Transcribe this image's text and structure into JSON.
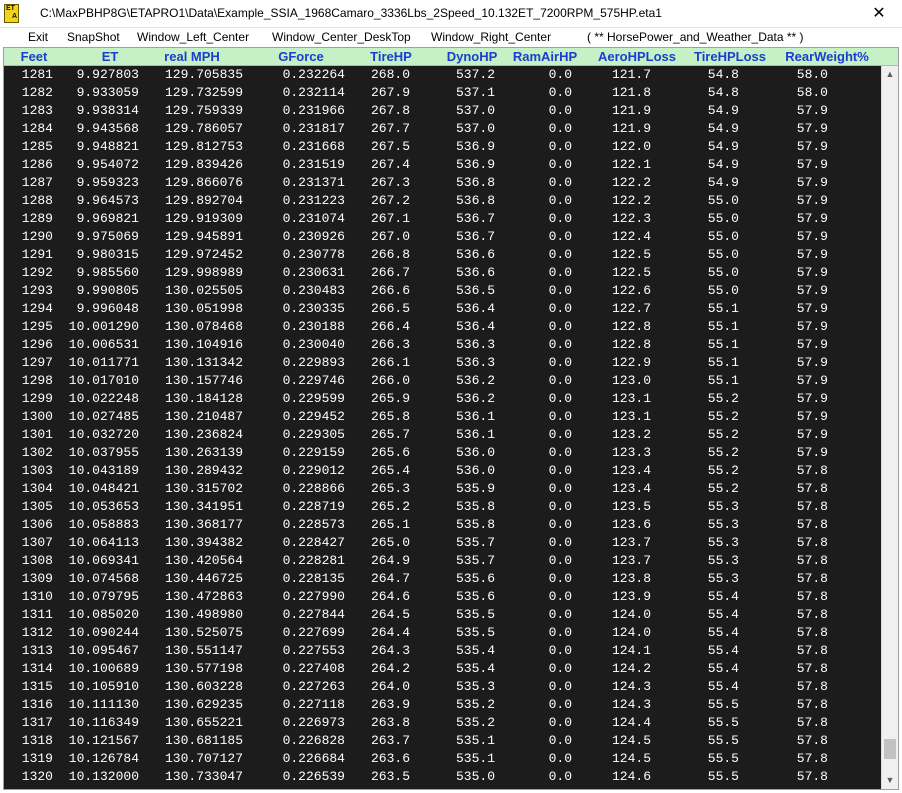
{
  "window": {
    "app_icon_text": [
      "ET",
      "A"
    ],
    "title": "C:\\MaxPBHP8G\\ETAPRO1\\Data\\Example_SSIA_1968Camaro_3336Lbs_2Speed_10.132ET_7200RPM_575HP.eta1",
    "close_glyph": "✕"
  },
  "menu": {
    "items": [
      "Exit",
      "SnapShot",
      "Window_Left_Center",
      "Window_Center_DeskTop",
      "Window_Right_Center"
    ],
    "note": "( ** HorsePower_and_Weather_Data ** )"
  },
  "table": {
    "columns": [
      "Feet",
      "ET",
      "real MPH",
      "GForce",
      "TireHP",
      "DynoHP",
      "RamAirHP",
      "AeroHPLoss",
      "TireHPLoss",
      "RearWeight%"
    ],
    "rows": [
      [
        "1281",
        "9.927803",
        "129.705835",
        "0.232264",
        "268.0",
        "537.2",
        "0.0",
        "121.7",
        "54.8",
        "58.0"
      ],
      [
        "1282",
        "9.933059",
        "129.732599",
        "0.232114",
        "267.9",
        "537.1",
        "0.0",
        "121.8",
        "54.8",
        "58.0"
      ],
      [
        "1283",
        "9.938314",
        "129.759339",
        "0.231966",
        "267.8",
        "537.0",
        "0.0",
        "121.9",
        "54.9",
        "57.9"
      ],
      [
        "1284",
        "9.943568",
        "129.786057",
        "0.231817",
        "267.7",
        "537.0",
        "0.0",
        "121.9",
        "54.9",
        "57.9"
      ],
      [
        "1285",
        "9.948821",
        "129.812753",
        "0.231668",
        "267.5",
        "536.9",
        "0.0",
        "122.0",
        "54.9",
        "57.9"
      ],
      [
        "1286",
        "9.954072",
        "129.839426",
        "0.231519",
        "267.4",
        "536.9",
        "0.0",
        "122.1",
        "54.9",
        "57.9"
      ],
      [
        "1287",
        "9.959323",
        "129.866076",
        "0.231371",
        "267.3",
        "536.8",
        "0.0",
        "122.2",
        "54.9",
        "57.9"
      ],
      [
        "1288",
        "9.964573",
        "129.892704",
        "0.231223",
        "267.2",
        "536.8",
        "0.0",
        "122.2",
        "55.0",
        "57.9"
      ],
      [
        "1289",
        "9.969821",
        "129.919309",
        "0.231074",
        "267.1",
        "536.7",
        "0.0",
        "122.3",
        "55.0",
        "57.9"
      ],
      [
        "1290",
        "9.975069",
        "129.945891",
        "0.230926",
        "267.0",
        "536.7",
        "0.0",
        "122.4",
        "55.0",
        "57.9"
      ],
      [
        "1291",
        "9.980315",
        "129.972452",
        "0.230778",
        "266.8",
        "536.6",
        "0.0",
        "122.5",
        "55.0",
        "57.9"
      ],
      [
        "1292",
        "9.985560",
        "129.998989",
        "0.230631",
        "266.7",
        "536.6",
        "0.0",
        "122.5",
        "55.0",
        "57.9"
      ],
      [
        "1293",
        "9.990805",
        "130.025505",
        "0.230483",
        "266.6",
        "536.5",
        "0.0",
        "122.6",
        "55.0",
        "57.9"
      ],
      [
        "1294",
        "9.996048",
        "130.051998",
        "0.230335",
        "266.5",
        "536.4",
        "0.0",
        "122.7",
        "55.1",
        "57.9"
      ],
      [
        "1295",
        "10.001290",
        "130.078468",
        "0.230188",
        "266.4",
        "536.4",
        "0.0",
        "122.8",
        "55.1",
        "57.9"
      ],
      [
        "1296",
        "10.006531",
        "130.104916",
        "0.230040",
        "266.3",
        "536.3",
        "0.0",
        "122.8",
        "55.1",
        "57.9"
      ],
      [
        "1297",
        "10.011771",
        "130.131342",
        "0.229893",
        "266.1",
        "536.3",
        "0.0",
        "122.9",
        "55.1",
        "57.9"
      ],
      [
        "1298",
        "10.017010",
        "130.157746",
        "0.229746",
        "266.0",
        "536.2",
        "0.0",
        "123.0",
        "55.1",
        "57.9"
      ],
      [
        "1299",
        "10.022248",
        "130.184128",
        "0.229599",
        "265.9",
        "536.2",
        "0.0",
        "123.1",
        "55.2",
        "57.9"
      ],
      [
        "1300",
        "10.027485",
        "130.210487",
        "0.229452",
        "265.8",
        "536.1",
        "0.0",
        "123.1",
        "55.2",
        "57.9"
      ],
      [
        "1301",
        "10.032720",
        "130.236824",
        "0.229305",
        "265.7",
        "536.1",
        "0.0",
        "123.2",
        "55.2",
        "57.9"
      ],
      [
        "1302",
        "10.037955",
        "130.263139",
        "0.229159",
        "265.6",
        "536.0",
        "0.0",
        "123.3",
        "55.2",
        "57.9"
      ],
      [
        "1303",
        "10.043189",
        "130.289432",
        "0.229012",
        "265.4",
        "536.0",
        "0.0",
        "123.4",
        "55.2",
        "57.8"
      ],
      [
        "1304",
        "10.048421",
        "130.315702",
        "0.228866",
        "265.3",
        "535.9",
        "0.0",
        "123.4",
        "55.2",
        "57.8"
      ],
      [
        "1305",
        "10.053653",
        "130.341951",
        "0.228719",
        "265.2",
        "535.8",
        "0.0",
        "123.5",
        "55.3",
        "57.8"
      ],
      [
        "1306",
        "10.058883",
        "130.368177",
        "0.228573",
        "265.1",
        "535.8",
        "0.0",
        "123.6",
        "55.3",
        "57.8"
      ],
      [
        "1307",
        "10.064113",
        "130.394382",
        "0.228427",
        "265.0",
        "535.7",
        "0.0",
        "123.7",
        "55.3",
        "57.8"
      ],
      [
        "1308",
        "10.069341",
        "130.420564",
        "0.228281",
        "264.9",
        "535.7",
        "0.0",
        "123.7",
        "55.3",
        "57.8"
      ],
      [
        "1309",
        "10.074568",
        "130.446725",
        "0.228135",
        "264.7",
        "535.6",
        "0.0",
        "123.8",
        "55.3",
        "57.8"
      ],
      [
        "1310",
        "10.079795",
        "130.472863",
        "0.227990",
        "264.6",
        "535.6",
        "0.0",
        "123.9",
        "55.4",
        "57.8"
      ],
      [
        "1311",
        "10.085020",
        "130.498980",
        "0.227844",
        "264.5",
        "535.5",
        "0.0",
        "124.0",
        "55.4",
        "57.8"
      ],
      [
        "1312",
        "10.090244",
        "130.525075",
        "0.227699",
        "264.4",
        "535.5",
        "0.0",
        "124.0",
        "55.4",
        "57.8"
      ],
      [
        "1313",
        "10.095467",
        "130.551147",
        "0.227553",
        "264.3",
        "535.4",
        "0.0",
        "124.1",
        "55.4",
        "57.8"
      ],
      [
        "1314",
        "10.100689",
        "130.577198",
        "0.227408",
        "264.2",
        "535.4",
        "0.0",
        "124.2",
        "55.4",
        "57.8"
      ],
      [
        "1315",
        "10.105910",
        "130.603228",
        "0.227263",
        "264.0",
        "535.3",
        "0.0",
        "124.3",
        "55.4",
        "57.8"
      ],
      [
        "1316",
        "10.111130",
        "130.629235",
        "0.227118",
        "263.9",
        "535.2",
        "0.0",
        "124.3",
        "55.5",
        "57.8"
      ],
      [
        "1317",
        "10.116349",
        "130.655221",
        "0.226973",
        "263.8",
        "535.2",
        "0.0",
        "124.4",
        "55.5",
        "57.8"
      ],
      [
        "1318",
        "10.121567",
        "130.681185",
        "0.226828",
        "263.7",
        "535.1",
        "0.0",
        "124.5",
        "55.5",
        "57.8"
      ],
      [
        "1319",
        "10.126784",
        "130.707127",
        "0.226684",
        "263.6",
        "535.1",
        "0.0",
        "124.5",
        "55.5",
        "57.8"
      ],
      [
        "1320",
        "10.132000",
        "130.733047",
        "0.226539",
        "263.5",
        "535.0",
        "0.0",
        "124.6",
        "55.5",
        "57.8"
      ]
    ]
  },
  "scrollbar": {
    "up_glyph": "▲",
    "down_glyph": "▼",
    "position_fraction": 0.98
  },
  "colors": {
    "header_bg": "#c6f0c6",
    "header_text": "#1a3fcf",
    "grid_bg": "#1c1c1c",
    "cell_text": "#ffffff",
    "app_icon_bg": "#f2d21c"
  }
}
